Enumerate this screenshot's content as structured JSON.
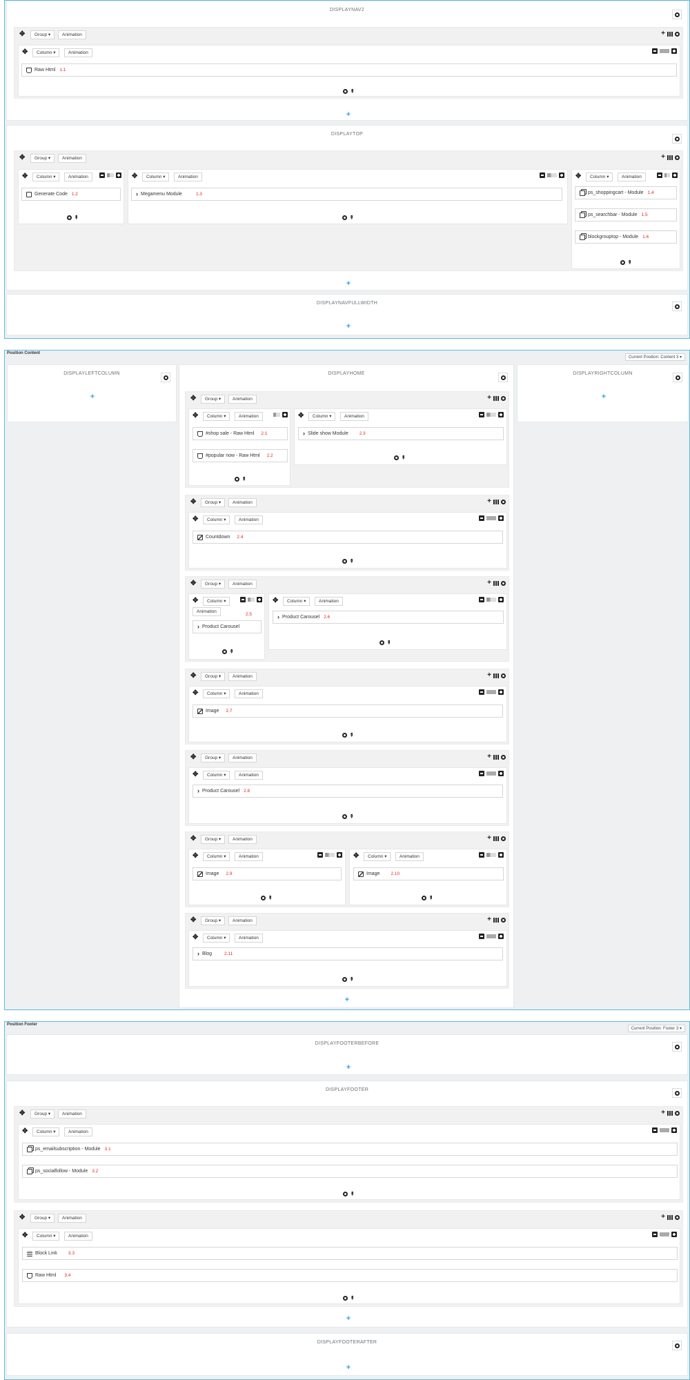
{
  "ui": {
    "group": "Group ▾",
    "column": "Column ▾",
    "animation": "Animation"
  },
  "header_area": {
    "hooks": {
      "nav2": "DISPLAYNAV2",
      "top": "DISPLAYTOP",
      "navfull": "DISPLAYNAVFULLWIDTH"
    },
    "modules": {
      "raw_html_1": {
        "label": "Raw Html",
        "num": "1.1"
      },
      "gen_code": {
        "label": "Generate Code",
        "num": "1.2"
      },
      "megamenu": {
        "label": "Megamenu Module",
        "num": "1.3"
      },
      "shoppingcart": {
        "label": "ps_shoppingcart - Module",
        "num": "1.4"
      },
      "searchbar": {
        "label": "ps_searchbar - Module",
        "num": "1.5"
      },
      "grouptop": {
        "label": "blockgrouptop - Module",
        "num": "1.6"
      }
    }
  },
  "content_area": {
    "title": "Position Content",
    "position_select": "Current Position: Content 3 ▾",
    "hooks": {
      "left": "DISPLAYLEFTCOLUMN",
      "home": "DISPLAYHOME",
      "right": "DISPLAYRIGHTCOLUMN"
    },
    "modules": {
      "shop_sale": {
        "label": "#shop sale - Raw Html",
        "num": "2.1"
      },
      "popular_now": {
        "label": "#popular now - Raw Html",
        "num": "2.2"
      },
      "slideshow": {
        "label": "Slide show Module",
        "num": "2.3"
      },
      "countdown": {
        "label": "Countdown",
        "num": "2.4"
      },
      "carousel_a": {
        "label": "Product Carousel",
        "num": "2.5"
      },
      "carousel_b": {
        "label": "Product Carousel",
        "num": "2.6"
      },
      "image_a": {
        "label": "Image",
        "num": "2.7"
      },
      "carousel_c": {
        "label": "Product Carousel",
        "num": "2.8"
      },
      "image_b": {
        "label": "Image",
        "num": "2.9"
      },
      "image_c": {
        "label": "Image",
        "num": "2.10"
      },
      "blog": {
        "label": "Blog",
        "num": "2.11"
      }
    }
  },
  "footer_area": {
    "title": "Position Footer",
    "position_select": "Current Position: Footer 3 ▾",
    "hooks": {
      "before": "DISPLAYFOOTERBEFORE",
      "footer": "DISPLAYFOOTER",
      "after": "DISPLAYFOOTERAFTER"
    },
    "modules": {
      "email": {
        "label": "ps_emailsubscription - Module",
        "num": "3.1"
      },
      "social": {
        "label": "ps_socialfollow - Module",
        "num": "3.2"
      },
      "blocklink": {
        "label": "Block Link",
        "num": "3.3"
      },
      "raw_html_2": {
        "label": "Raw Html",
        "num": "3.4"
      }
    }
  },
  "icons": [
    "move-icon",
    "gear-icon",
    "plus-icon",
    "grid-icon",
    "minus-icon",
    "pencil-icon",
    "html5-icon",
    "image-icon",
    "chevron-right-icon",
    "list-icon",
    "edit-icon",
    "copy-icon"
  ]
}
